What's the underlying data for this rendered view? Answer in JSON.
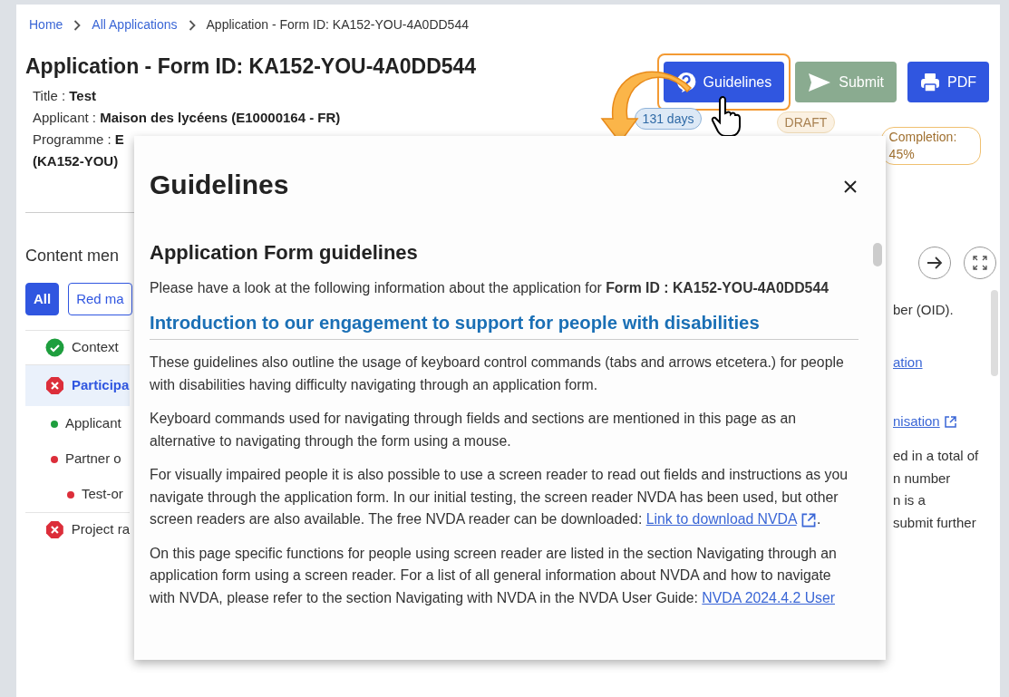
{
  "breadcrumb": [
    {
      "label": "Home",
      "link": true
    },
    {
      "label": "All Applications",
      "link": true
    },
    {
      "label": "Application - Form ID: KA152-YOU-4A0DD544",
      "link": false
    }
  ],
  "page_title": "Application - Form ID: KA152-YOU-4A0DD544",
  "actions": [
    {
      "label": "Guidelines",
      "kind": "guidelines",
      "highlighted": true,
      "disabled": false
    },
    {
      "label": "Submit",
      "kind": "submit",
      "highlighted": false,
      "disabled": true
    },
    {
      "label": "PDF",
      "kind": "pdf",
      "highlighted": false,
      "disabled": false
    }
  ],
  "details": [
    {
      "label": "Title :",
      "value": "Test"
    },
    {
      "label": "Applicant :",
      "value": "Maison des lycéens (E10000164 - FR)"
    },
    {
      "label": "Programme :",
      "value": "E"
    }
  ],
  "details_continuation": "(KA152-YOU)",
  "badges": [
    {
      "label": "131 days",
      "kind": "deadline"
    },
    {
      "label": "DRAFT",
      "kind": "status"
    },
    {
      "label": "Completion: 45%",
      "kind": "completion"
    }
  ],
  "content_menu": {
    "title": "Content men",
    "filters": [
      {
        "label": "All",
        "selected": true
      },
      {
        "label": "Red ma",
        "selected": false
      }
    ],
    "items": [
      {
        "label": "Context",
        "kind": "complete",
        "selected": false
      },
      {
        "label": "Participa",
        "kind": "error",
        "selected": true,
        "children": [
          {
            "label": "Applicant",
            "color": "#1e9e3e"
          },
          {
            "label": "Partner o",
            "color": "#dc2e3a",
            "children": [
              {
                "label": "Test-or",
                "color": "#dc2e3a"
              }
            ]
          }
        ]
      },
      {
        "label": "Project ra",
        "kind": "error",
        "selected": false
      }
    ]
  },
  "right_panel": {
    "lines": [
      {
        "kind": "text",
        "text": "ber (OID)."
      },
      {
        "kind": "link",
        "text": "ation"
      },
      {
        "kind": "external_link",
        "text": "nisation"
      },
      {
        "kind": "text",
        "text": "ed in a total of"
      },
      {
        "kind": "text",
        "text": "n number"
      },
      {
        "kind": "text",
        "text": "n is a"
      },
      {
        "kind": "text",
        "text": "submit further"
      }
    ]
  },
  "modal": {
    "title": "Guidelines",
    "heading": "Application Form guidelines",
    "intro": "Please have a look at the following information about the application for **Form ID : KA152-YOU-4A0DD544**",
    "section_title": "Introduction to our engagement to support for people with disabilities",
    "paragraphs": [
      {
        "text": "These guidelines also outline the usage of keyboard control commands (tabs and arrows etcetera.) for people with disabilities having difficulty navigating through an application form."
      },
      {
        "text": "Keyboard commands used for navigating through fields and sections are mentioned in this page as an alternative to navigating through the form using a mouse."
      },
      {
        "text": "For visually impaired people it is also possible to use a screen reader to read out fields and instructions as you navigate through the application form. In our initial testing, the screen reader NVDA has been used, but other screen readers are also available. The free NVDA reader can be downloaded:",
        "link": "Link to download NVDA",
        "external": true,
        "after": "."
      },
      {
        "text": "On this page specific functions for people using screen reader are listed in the section Navigating through an application form using a screen reader. For a list of all general information about NVDA and how to navigate with NVDA, please refer to the section Navigating with NVDA in the NVDA User Guide:",
        "link": "NVDA 2024.4.2 User",
        "external": false
      }
    ]
  }
}
